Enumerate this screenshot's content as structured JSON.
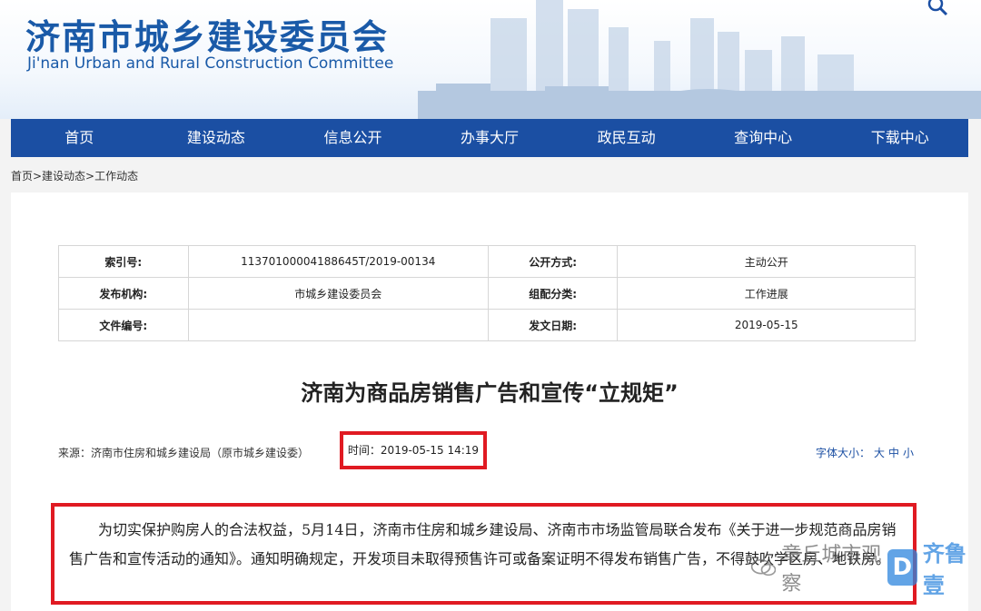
{
  "header": {
    "title": "济南市城乡建设委员会",
    "subtitle": "Ji'nan Urban and Rural Construction Committee"
  },
  "nav": {
    "items": [
      "首页",
      "建设动态",
      "信息公开",
      "办事大厅",
      "政民互动",
      "查询中心",
      "下载中心"
    ]
  },
  "breadcrumb": "首页>建设动态>工作动态",
  "meta": {
    "index_label": "索引号:",
    "index_value": "11370100004188645T/2019-00134",
    "open_label": "公开方式:",
    "open_value": "主动公开",
    "org_label": "发布机构:",
    "org_value": "市城乡建设委员会",
    "category_label": "组配分类:",
    "category_value": "工作进展",
    "doc_label": "文件编号:",
    "doc_value": "",
    "date_label": "发文日期:",
    "date_value": "2019-05-15"
  },
  "article": {
    "title": "济南为商品房销售广告和宣传“立规矩”",
    "source": "来源：济南市住房和城乡建设局（原市城乡建设委）",
    "time": "时间：2019-05-15 14:19",
    "font_size_label": "字体大小：",
    "font_large": "大",
    "font_medium": "中",
    "font_small": "小",
    "body": "为切实保护购房人的合法权益，5月14日，济南市住房和城乡建设局、济南市市场监管局联合发布《关于进一步规范商品房销售广告和宣传活动的通知》。通知明确规定，开发项目未取得预售许可或备案证明不得发布销售广告，不得鼓吹学区房、地铁房。"
  },
  "watermark": {
    "text": "章丘城市观察",
    "brand": "齐鲁壹"
  },
  "colors": {
    "nav_bg": "#1b4fa3",
    "title_blue": "#1a5aa8",
    "highlight_red": "#e01a22"
  }
}
